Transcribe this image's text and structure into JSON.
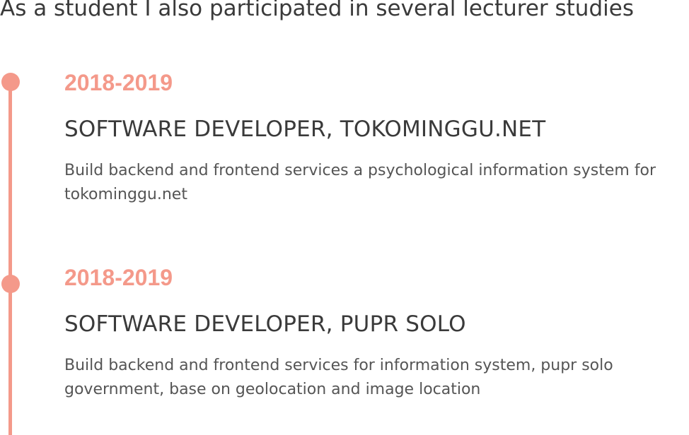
{
  "intro": {
    "text": "As a student I also participated in several lecturer studies"
  },
  "timeline": {
    "accent_color": "#f4998a",
    "entries": [
      {
        "year": "2018-2019",
        "title": "SOFTWARE DEVELOPER, TOKOMINGGU.NET",
        "description": "Build backend and frontend services a psychological information system for tokominggu.net"
      },
      {
        "year": "2018-2019",
        "title": "SOFTWARE DEVELOPER, PUPR SOLO",
        "description": "Build backend and frontend services for information system, pupr solo government, base on geolocation and image location"
      }
    ]
  }
}
